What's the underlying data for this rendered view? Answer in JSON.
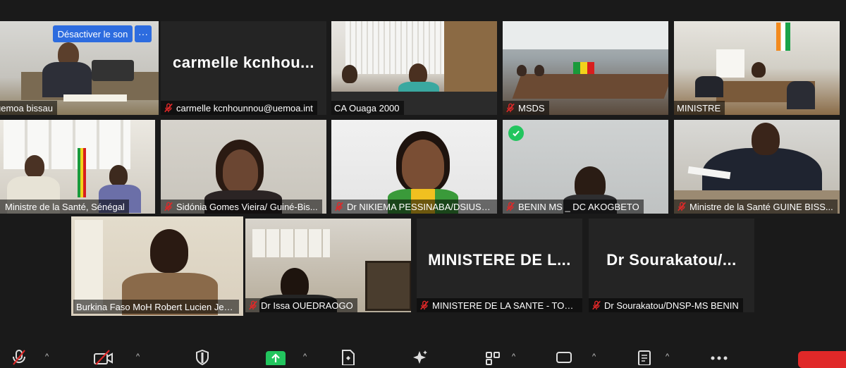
{
  "tiles": [
    {
      "name": "uemoa bissau",
      "muted": false
    },
    {
      "name": "carmelle kcnhounnou@uemoa.int",
      "big_name": "carmelle  kcnhou...",
      "muted": true
    },
    {
      "name": "CA Ouaga 2000",
      "muted": false
    },
    {
      "name": "MSDS",
      "muted": true
    },
    {
      "name": "MINISTRE",
      "muted": false
    },
    {
      "name": "Ministre de la Santé, Sénégal",
      "muted": false
    },
    {
      "name": "Sidónia Gomes Vieira/ Guiné-Bis...",
      "muted": true
    },
    {
      "name": "Dr NIKIEMA PESSINABA/DSIUSR...",
      "muted": true
    },
    {
      "name": "BENIN MS _ DC AKOGBETO",
      "muted": true
    },
    {
      "name": "Ministre de la Santé GUINE BISS...",
      "muted": true
    },
    {
      "name": "Burkina Faso MoH Robert Lucien Jea...",
      "muted": false
    },
    {
      "name": "Dr Issa OUEDRAOGO",
      "muted": true
    },
    {
      "name": "MINISTERE DE LA SANTE - TOGO",
      "big_name": "MINISTERE  DE  L...",
      "muted": true
    },
    {
      "name": "Dr Sourakatou/DNSP-MS BENIN",
      "big_name": "Dr  Sourakatou/...",
      "muted": true
    }
  ],
  "overlay": {
    "unmute_label": "Désactiver le son",
    "more_label": "···"
  },
  "toolbar": {
    "items": [
      "mic-muted-icon",
      "camera-off-icon",
      "security-icon",
      "share-screen-icon",
      "document-icon",
      "ai-sparkle-icon",
      "apps-icon",
      "chat-icon",
      "notes-icon",
      "more-icon",
      "end-button"
    ],
    "caret": "^"
  },
  "colors": {
    "background": "#1a1a1a",
    "tile": "#242424",
    "active_speaker": "#c9e25b",
    "muted": "#e02828",
    "accent": "#2d6cdf",
    "green": "#22c55e"
  }
}
